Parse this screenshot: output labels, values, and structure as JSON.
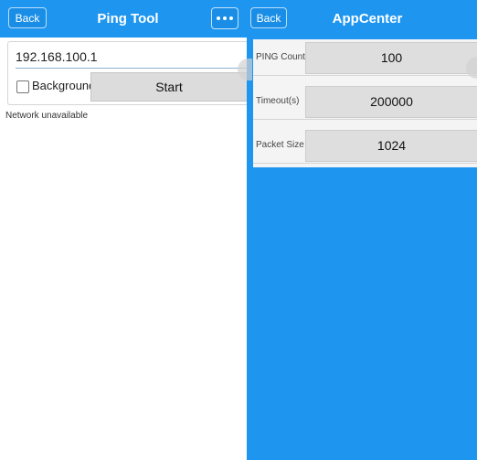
{
  "ping_tool": {
    "header": {
      "back_label": "Back",
      "title": "Ping Tool"
    },
    "ip_value": "192.168.100.1",
    "background_label": "Background",
    "background_checked": false,
    "start_label": "Start",
    "status_text": "Network unavailable"
  },
  "app_center": {
    "header": {
      "back_label": "Back",
      "title": "AppCenter"
    },
    "settings": [
      {
        "label": "PING Count",
        "value": "100"
      },
      {
        "label": "Timeout(s)",
        "value": "200000"
      },
      {
        "label": "Packet Size",
        "value": "1024"
      }
    ]
  },
  "colors": {
    "accent": "#1e96f0",
    "button_grey": "#dcdcdc"
  },
  "icons": {
    "more": "more-dots-icon"
  }
}
